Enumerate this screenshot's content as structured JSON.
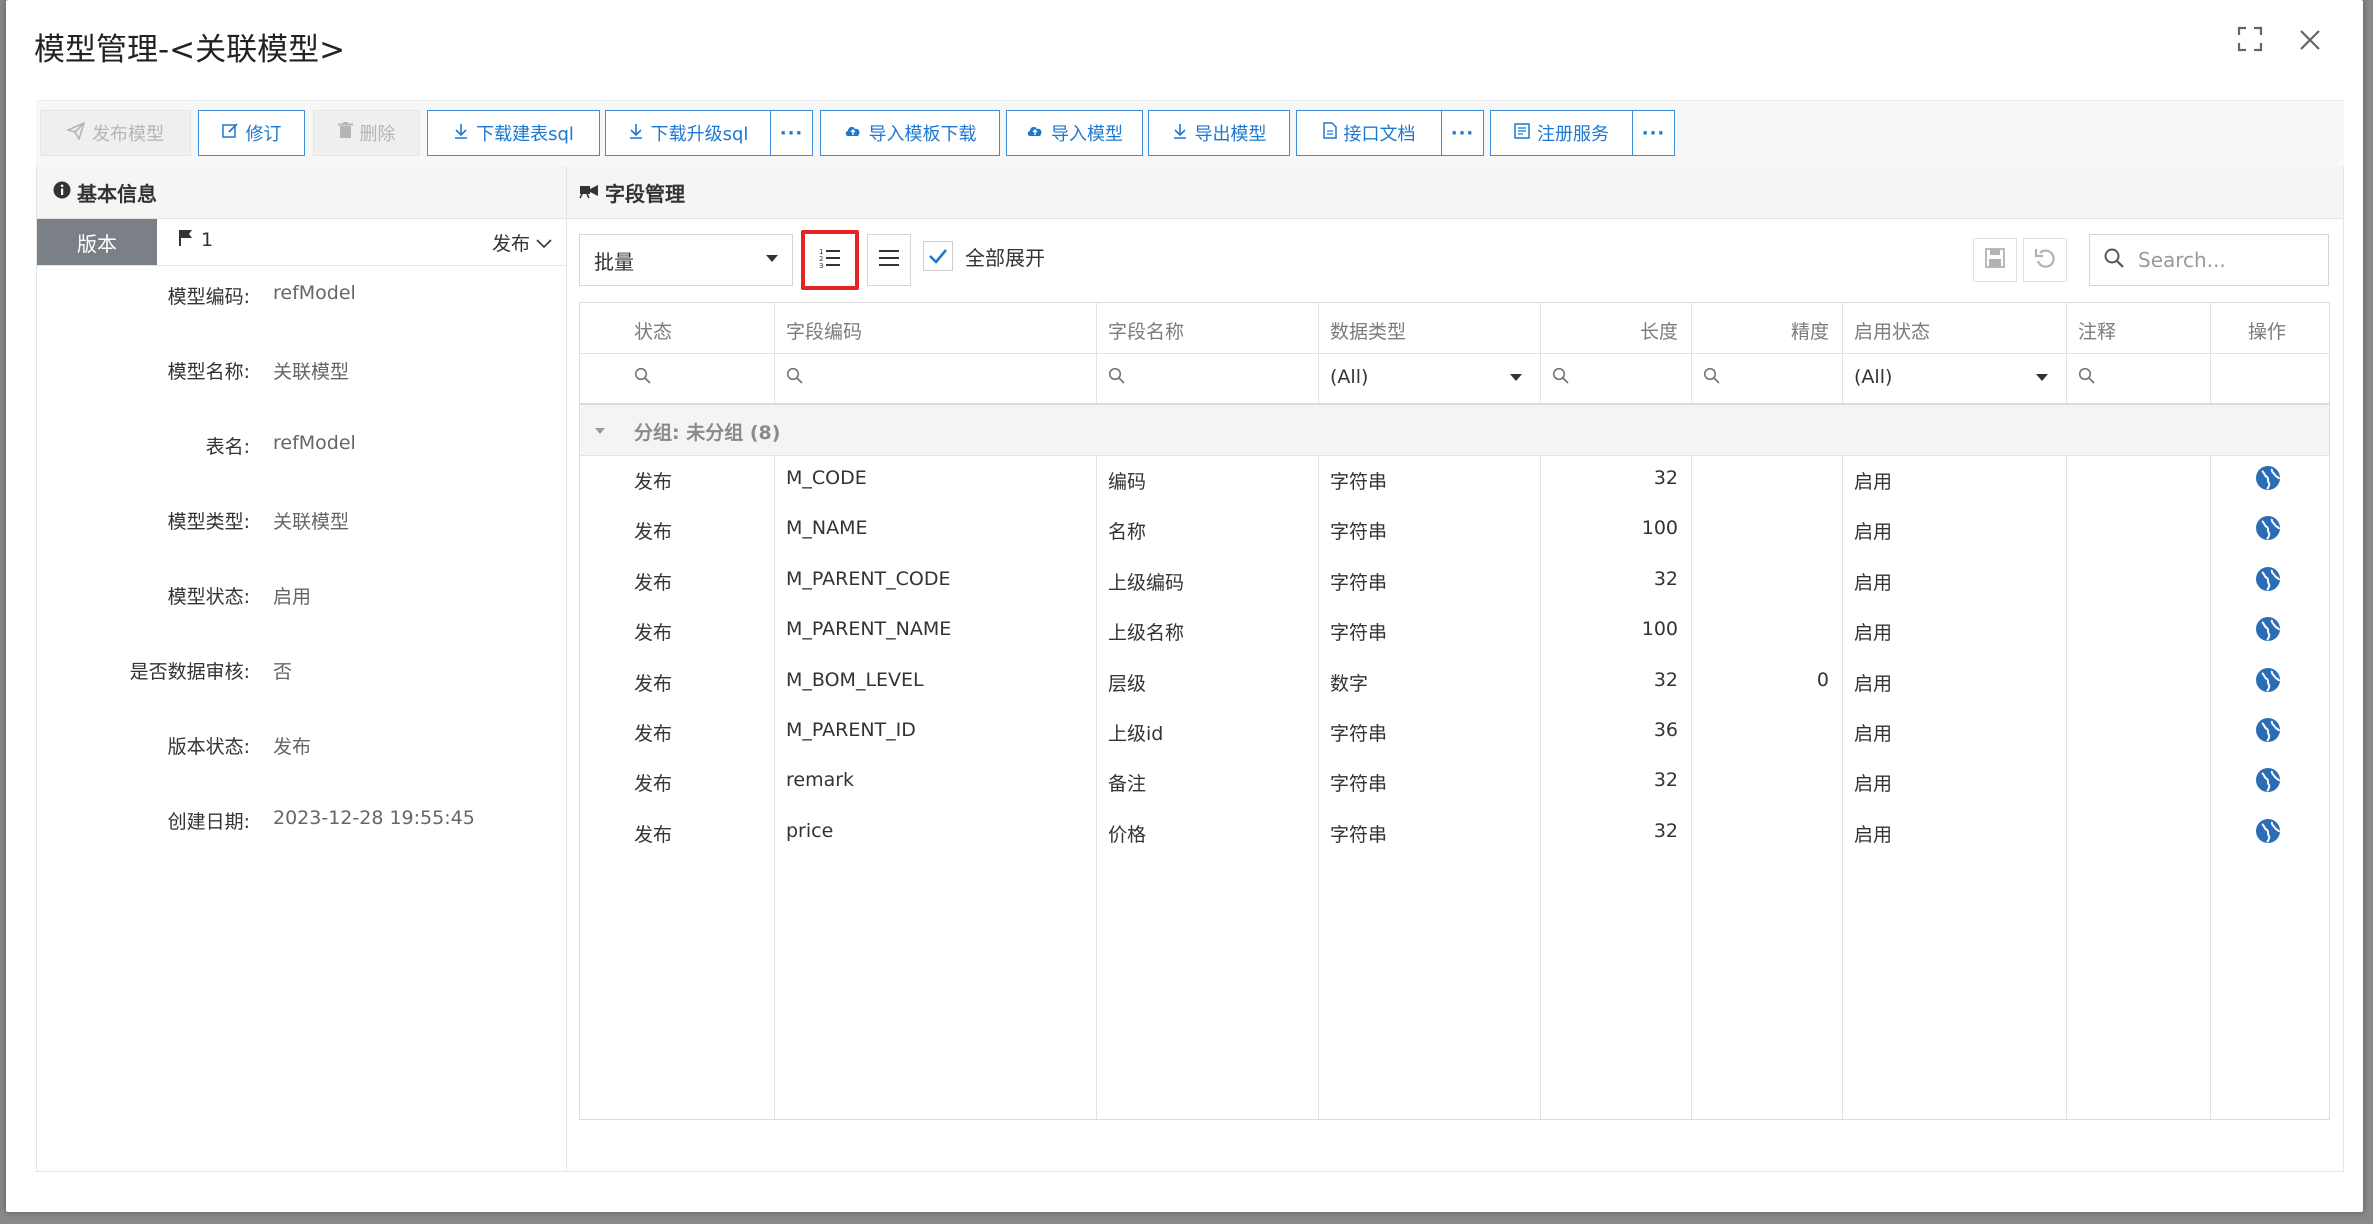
{
  "dialog": {
    "title": "模型管理-<关联模型>",
    "maximize_icon": "maximize-icon",
    "close_icon": "close-icon"
  },
  "toolbar": {
    "publish": "发布模型",
    "revise": "修订",
    "delete": "删除",
    "download_create_sql": "下载建表sql",
    "download_upgrade_sql": "下载升级sql",
    "import_template": "导入模板下载",
    "import_model": "导入模型",
    "export_model": "导出模型",
    "api_doc": "接口文档",
    "register_service": "注册服务",
    "more": "···"
  },
  "basic_info": {
    "header": "基本信息",
    "version_tab": "版本",
    "version_number": "1",
    "version_status": "发布",
    "fields": [
      {
        "label": "模型编码:",
        "value": "refModel"
      },
      {
        "label": "模型名称:",
        "value": "关联模型"
      },
      {
        "label": "表名:",
        "value": "refModel"
      },
      {
        "label": "模型类型:",
        "value": "关联模型"
      },
      {
        "label": "模型状态:",
        "value": "启用"
      },
      {
        "label": "是否数据审核:",
        "value": "否"
      },
      {
        "label": "版本状态:",
        "value": "发布"
      },
      {
        "label": "创建日期:",
        "value": "2023-12-28 19:55:45"
      }
    ]
  },
  "field_mgmt": {
    "header": "字段管理",
    "batch": "批量",
    "expand_all": "全部展开",
    "expand_all_checked": true,
    "search_placeholder": "Search...",
    "columns": [
      "状态",
      "字段编码",
      "字段名称",
      "数据类型",
      "长度",
      "精度",
      "启用状态",
      "注释",
      "操作"
    ],
    "filter_all": "(All)",
    "group_label": "分组: 未分组 (8)",
    "rows": [
      {
        "status": "发布",
        "code": "M_CODE",
        "name": "编码",
        "type": "字符串",
        "length": "32",
        "precision": "",
        "enabled": "启用",
        "comment": ""
      },
      {
        "status": "发布",
        "code": "M_NAME",
        "name": "名称",
        "type": "字符串",
        "length": "100",
        "precision": "",
        "enabled": "启用",
        "comment": ""
      },
      {
        "status": "发布",
        "code": "M_PARENT_CODE",
        "name": "上级编码",
        "type": "字符串",
        "length": "32",
        "precision": "",
        "enabled": "启用",
        "comment": ""
      },
      {
        "status": "发布",
        "code": "M_PARENT_NAME",
        "name": "上级名称",
        "type": "字符串",
        "length": "100",
        "precision": "",
        "enabled": "启用",
        "comment": ""
      },
      {
        "status": "发布",
        "code": "M_BOM_LEVEL",
        "name": "层级",
        "type": "数字",
        "length": "32",
        "precision": "0",
        "enabled": "启用",
        "comment": ""
      },
      {
        "status": "发布",
        "code": "M_PARENT_ID",
        "name": "上级id",
        "type": "字符串",
        "length": "36",
        "precision": "",
        "enabled": "启用",
        "comment": ""
      },
      {
        "status": "发布",
        "code": "remark",
        "name": "备注",
        "type": "字符串",
        "length": "32",
        "precision": "",
        "enabled": "启用",
        "comment": ""
      },
      {
        "status": "发布",
        "code": "price",
        "name": "价格",
        "type": "字符串",
        "length": "32",
        "precision": "",
        "enabled": "启用",
        "comment": ""
      }
    ]
  },
  "colors": {
    "accent": "#1e78d2",
    "highlight_border": "#e52323",
    "version_tab": "#7b7f86",
    "globe": "#2a6cb6"
  }
}
